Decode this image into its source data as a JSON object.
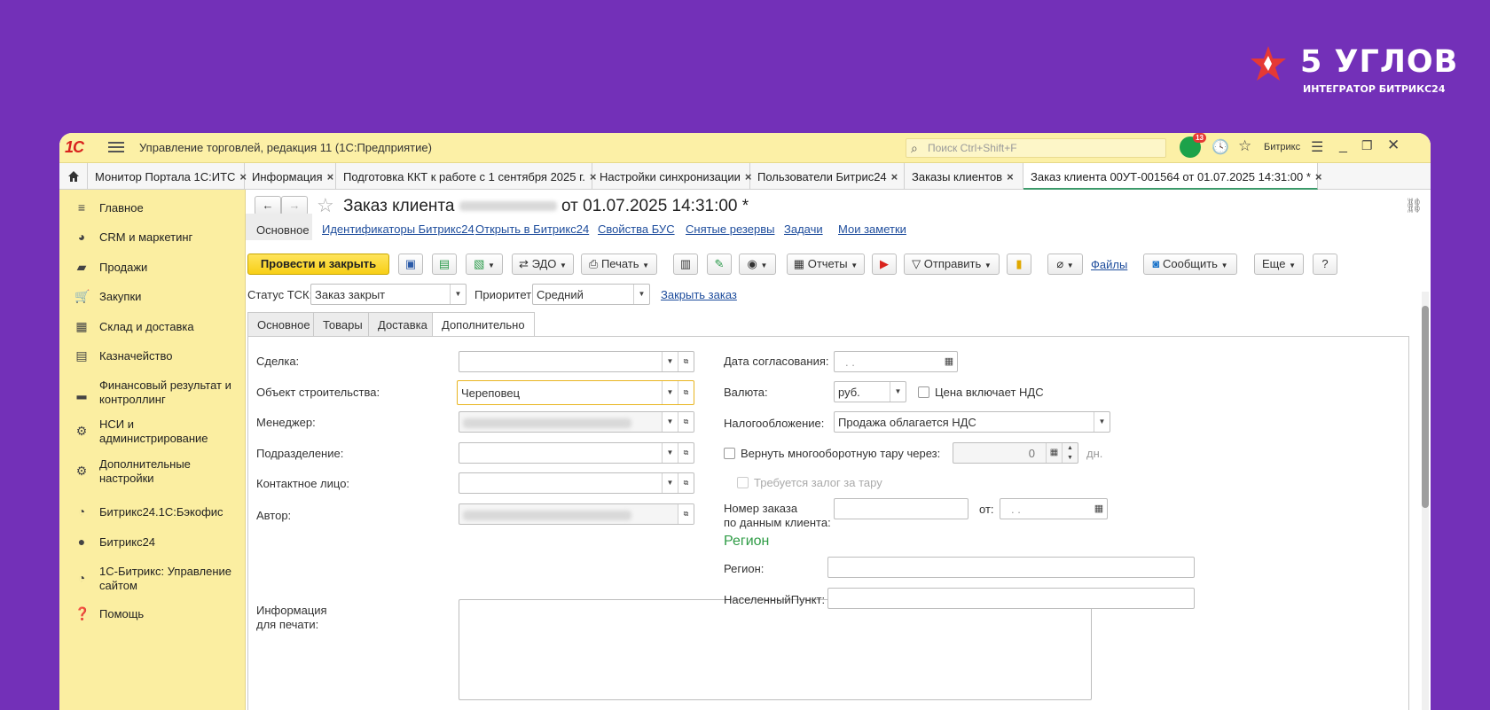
{
  "brand": {
    "title": "5 УГЛОВ",
    "subtitle": "ИНТЕГРАТОР БИТРИКС24",
    "star_color": "#e53935"
  },
  "titlebar": {
    "logo": "1С",
    "app_title": "Управление торговлей, редакция 11  (1С:Предприятие)",
    "search_placeholder": "Поиск Ctrl+Shift+F",
    "notifications": "13",
    "user": "Битрикс"
  },
  "tabs": [
    {
      "label": "Монитор Портала 1С:ИТС"
    },
    {
      "label": "Информация"
    },
    {
      "label": "Подготовка ККТ к работе с 1 сентября 2025 г."
    },
    {
      "label": "Настройки синхронизации"
    },
    {
      "label": "Пользователи Битрис24"
    },
    {
      "label": "Заказы клиентов"
    },
    {
      "label": "Заказ клиента 00УТ-001564 от 01.07.2025 14:31:00 *"
    }
  ],
  "sidebar": {
    "items": [
      {
        "label": "Главное",
        "icon": "menu-icon"
      },
      {
        "label": "CRM и маркетинг",
        "icon": "pie-chart-icon"
      },
      {
        "label": "Продажи",
        "icon": "bag-icon"
      },
      {
        "label": "Закупки",
        "icon": "cart-icon"
      },
      {
        "label": "Склад и доставка",
        "icon": "warehouse-icon"
      },
      {
        "label": "Казначейство",
        "icon": "cash-icon"
      },
      {
        "label": "Финансовый результат и контроллинг",
        "icon": "bar-chart-icon"
      },
      {
        "label": "НСИ и администрирование",
        "icon": "gear-icon"
      },
      {
        "label": "Дополнительные настройки",
        "icon": "gear-outline-icon"
      },
      {
        "label": "Битрикс24.1С:Бэкофис",
        "icon": "clock-icon"
      },
      {
        "label": "Битрикс24",
        "icon": "b24-icon"
      },
      {
        "label": "1С-Битрикс: Управление сайтом",
        "icon": "clock-icon"
      },
      {
        "label": "Помощь",
        "icon": "help-icon"
      }
    ]
  },
  "form": {
    "title": "Заказ клиента",
    "title_suffix": "от 01.07.2025 14:31:00 *",
    "nav_links": {
      "main": "Основное",
      "ids": "Идентификаторы Битрикс24",
      "open": "Открыть в Битрикс24",
      "props": "Свойства БУС",
      "reserves": "Снятые резервы",
      "tasks": "Задачи",
      "notes": "Мои заметки"
    },
    "toolbar": {
      "post_close": "Провести и закрыть",
      "edo": "ЭДО",
      "print": "Печать",
      "reports": "Отчеты",
      "send": "Отправить",
      "files": "Файлы",
      "message": "Сообщить",
      "more": "Еще",
      "help": "?"
    },
    "status_label": "Статус ТСК:",
    "status_value": "Заказ закрыт",
    "priority_label": "Приоритет:",
    "priority_value": "Средний",
    "close_order": "Закрыть заказ",
    "inner_tabs": {
      "main": "Основное",
      "goods": "Товары",
      "delivery": "Доставка",
      "extra": "Дополнительно"
    },
    "left": {
      "deal": "Сделка:",
      "object": "Объект строительства:",
      "object_value": "Череповец",
      "manager": "Менеджер:",
      "division": "Подразделение:",
      "contact": "Контактное лицо:",
      "author": "Автор:",
      "print_info_1": "Информация",
      "print_info_2": "для печати:"
    },
    "right": {
      "approval_date": "Дата согласования:",
      "date_placeholder": ". .",
      "currency": "Валюта:",
      "currency_value": "руб.",
      "vat_included": "Цена включает НДС",
      "taxation": "Налогообложение:",
      "taxation_value": "Продажа облагается НДС",
      "return_tare": "Вернуть многооборотную тару через:",
      "days_value": "0",
      "days_unit": "дн.",
      "deposit": "Требуется залог за тару",
      "client_order_1": "Номер заказа",
      "client_order_2": "по данным клиента:",
      "from": "от:",
      "region_section": "Регион",
      "region": "Регион:",
      "locality": "НаселенныйПункт:"
    }
  }
}
